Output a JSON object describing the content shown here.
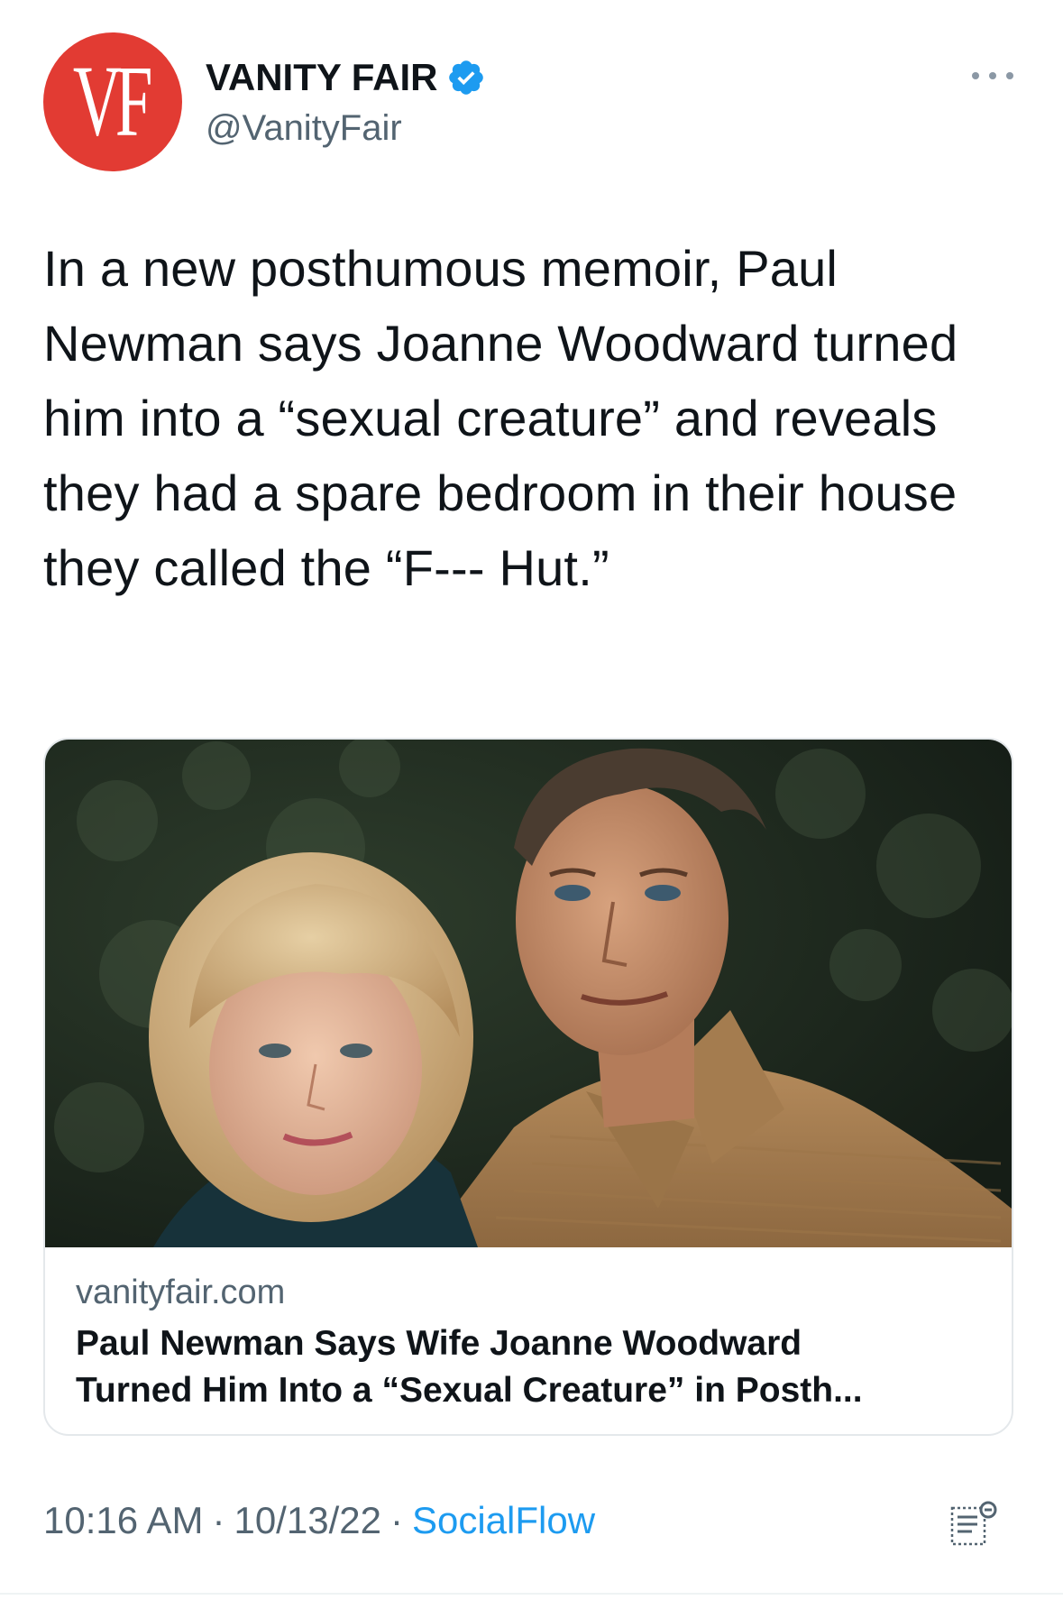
{
  "account": {
    "avatar_text": "VF",
    "avatar_color": "#e23b33",
    "display_name": "VANITY FAIR",
    "handle": "@VanityFair",
    "verified": true
  },
  "tweet": {
    "text": "In a new posthumous memoir, Paul Newman says Joanne Woodward turned him into a “sexual creature” and reveals they had a spare bedroom in their house they called the “F--- Hut.”"
  },
  "card": {
    "domain": "vanityfair.com",
    "title": "Paul Newman Says Wife Joanne Woodward\nTurned Him Into a “Sexual Creature” in Posth..."
  },
  "meta": {
    "time": "10:16 AM",
    "date": "10/13/22",
    "separator": "·",
    "source": "SocialFlow"
  },
  "colors": {
    "text_primary": "#0f1419",
    "text_secondary": "#536471",
    "link_blue": "#1d9bf0"
  },
  "icons": {
    "more": "more-icon",
    "verified": "verified-badge-icon",
    "analytics": "analytics-icon"
  }
}
